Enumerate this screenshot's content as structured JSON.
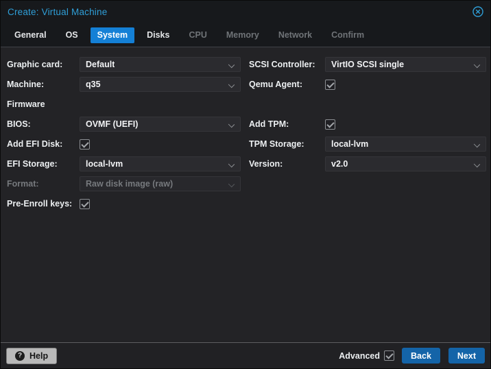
{
  "window": {
    "title": "Create: Virtual Machine"
  },
  "icons": {
    "close": "circle-x",
    "help": "?",
    "chevron_down": "v",
    "check": "✓"
  },
  "colors": {
    "title_text": "#2f9fd8",
    "header_bg": "#17191c",
    "content_bg": "#232326",
    "active_tab_bg": "#1480d6",
    "field_bg": "#2b2b2f",
    "button_bg": "#1464a8",
    "help_button_bg": "#b9b9b9"
  },
  "tabs": [
    {
      "label": "General",
      "state": "enabled"
    },
    {
      "label": "OS",
      "state": "enabled"
    },
    {
      "label": "System",
      "state": "active"
    },
    {
      "label": "Disks",
      "state": "enabled"
    },
    {
      "label": "CPU",
      "state": "disabled"
    },
    {
      "label": "Memory",
      "state": "disabled"
    },
    {
      "label": "Network",
      "state": "disabled"
    },
    {
      "label": "Confirm",
      "state": "disabled"
    }
  ],
  "form": {
    "left": [
      {
        "type": "select",
        "label": "Graphic card:",
        "value": "Default",
        "disabled": false
      },
      {
        "type": "select",
        "label": "Machine:",
        "value": "q35",
        "disabled": false
      },
      {
        "type": "heading",
        "label": "Firmware"
      },
      {
        "type": "select",
        "label": "BIOS:",
        "value": "OVMF (UEFI)",
        "disabled": false
      },
      {
        "type": "checkbox",
        "label": "Add EFI Disk:",
        "checked": true
      },
      {
        "type": "select",
        "label": "EFI Storage:",
        "value": "local-lvm",
        "disabled": false
      },
      {
        "type": "select",
        "label": "Format:",
        "value": "Raw disk image (raw)",
        "disabled": true
      },
      {
        "type": "checkbox",
        "label": "Pre-Enroll keys:",
        "checked": true
      }
    ],
    "right": [
      {
        "type": "select",
        "label": "SCSI Controller:",
        "value": "VirtIO SCSI single",
        "disabled": false
      },
      {
        "type": "checkbox",
        "label": "Qemu Agent:",
        "checked": true
      },
      {
        "type": "spacer"
      },
      {
        "type": "checkbox",
        "label": "Add TPM:",
        "checked": true
      },
      {
        "type": "select",
        "label": "TPM Storage:",
        "value": "local-lvm",
        "disabled": false
      },
      {
        "type": "select",
        "label": "Version:",
        "value": "v2.0",
        "disabled": false
      }
    ]
  },
  "footer": {
    "help_label": "Help",
    "advanced_label": "Advanced",
    "advanced_checked": true,
    "back_label": "Back",
    "next_label": "Next"
  }
}
